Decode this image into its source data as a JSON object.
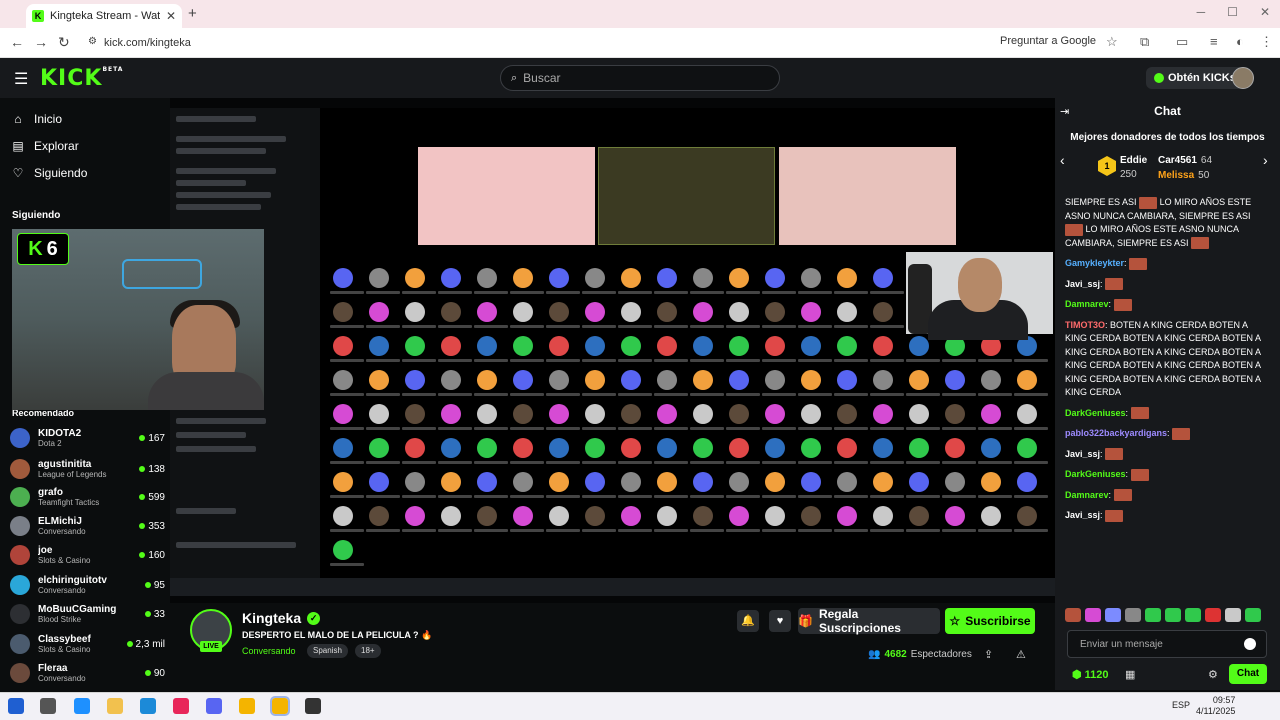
{
  "browser": {
    "tab_title": "Kingteka Stream - Watch Li",
    "url": "kick.com/kingteka",
    "ask_google": "Preguntar a Google"
  },
  "header": {
    "logo": "KICK",
    "logo_badge": "BETA",
    "search_placeholder": "Buscar",
    "kicks_button": "Obtén KICKs"
  },
  "sidebar": {
    "nav": [
      {
        "label": "Inicio",
        "icon": "home-icon"
      },
      {
        "label": "Explorar",
        "icon": "compass-icon"
      },
      {
        "label": "Siguiendo",
        "icon": "heart-icon"
      }
    ],
    "following_heading": "Siguiendo",
    "recommended_heading": "Recomendado",
    "recommended": [
      {
        "name": "KIDOTA2",
        "category": "Dota 2",
        "viewers": "167",
        "color": "#3c63c9"
      },
      {
        "name": "agustinitita",
        "category": "League of Legends",
        "viewers": "138",
        "color": "#a05a3c"
      },
      {
        "name": "grafo",
        "category": "Teamfight Tactics",
        "viewers": "599",
        "color": "#4caf50"
      },
      {
        "name": "ELMichiJ",
        "category": "Conversando",
        "viewers": "353",
        "color": "#7a7f88"
      },
      {
        "name": "joe",
        "category": "Slots & Casino",
        "viewers": "160",
        "color": "#b0443a"
      },
      {
        "name": "elchiringuitotv",
        "category": "Conversando",
        "viewers": "95",
        "color": "#2aa7d9"
      },
      {
        "name": "MoBuuCGaming",
        "category": "Blood Strike",
        "viewers": "33",
        "color": "#2d2f33"
      },
      {
        "name": "Classybeef",
        "category": "Slots & Casino",
        "viewers": "2,3 mil",
        "color": "#4b5b6e"
      },
      {
        "name": "Fleraa",
        "category": "Conversando",
        "viewers": "90",
        "color": "#6b4a3c"
      }
    ]
  },
  "overlay": {
    "kick_count": "6"
  },
  "stream": {
    "streamer": "Kingteka",
    "title": "DESPERTO EL MALO DE LA PELICULA ? 🔥",
    "category": "Conversando",
    "tags": [
      "Spanish",
      "18+"
    ],
    "gift_label": "Regala Suscripciones",
    "subscribe_label": "Suscribirse",
    "viewers": "4682",
    "viewers_label": "Espectadores",
    "live_badge": "LIVE"
  },
  "chat": {
    "title": "Chat",
    "donors_heading": "Mejores donadores de todos los tiempos",
    "donors": [
      {
        "name": "Eddie",
        "amount": "250"
      },
      {
        "name": "Car4561",
        "amount": "64"
      },
      {
        "name": "Melissa",
        "amount": "50"
      }
    ],
    "spam_text": "SIEMPRE ES ASI",
    "spam_text2": "LO MIRO AÑOS ESTE ASNO NUNCA CAMBIARA, SIEMPRE ES ASI",
    "messages": [
      {
        "user": "Gamykleykter",
        "text": ""
      },
      {
        "user": "Javi_ssj",
        "text": ""
      },
      {
        "user": "Damnarev",
        "text": ""
      },
      {
        "user": "TIMOT3O",
        "text": "BOTEN A KING CERDA  BOTEN A KING CERDA  BOTEN A KING CERDA  BOTEN A KING CERDA  BOTEN A KING CERDA  BOTEN A KING CERDA  BOTEN A KING CERDA  BOTEN A KING CERDA  BOTEN A KING CERDA  BOTEN A KING CERDA"
      },
      {
        "user": "DarkGeniuses",
        "text": ""
      },
      {
        "user": "pablo322backyardigans",
        "text": ""
      },
      {
        "user": "Javi_ssj",
        "text": ""
      },
      {
        "user": "DarkGeniuses",
        "text": ""
      },
      {
        "user": "Damnarev",
        "text": ""
      },
      {
        "user": "Javi_ssj",
        "text": ""
      }
    ],
    "input_placeholder": "Enviar un mensaje",
    "kicks_count": "1120",
    "send_label": "Chat"
  },
  "taskbar": {
    "lang": "ESP",
    "time": "09:57",
    "date": "4/11/2025"
  },
  "colors": {
    "brand": "#53fc18",
    "bg": "#0b0d0e",
    "panel": "#17191c"
  }
}
